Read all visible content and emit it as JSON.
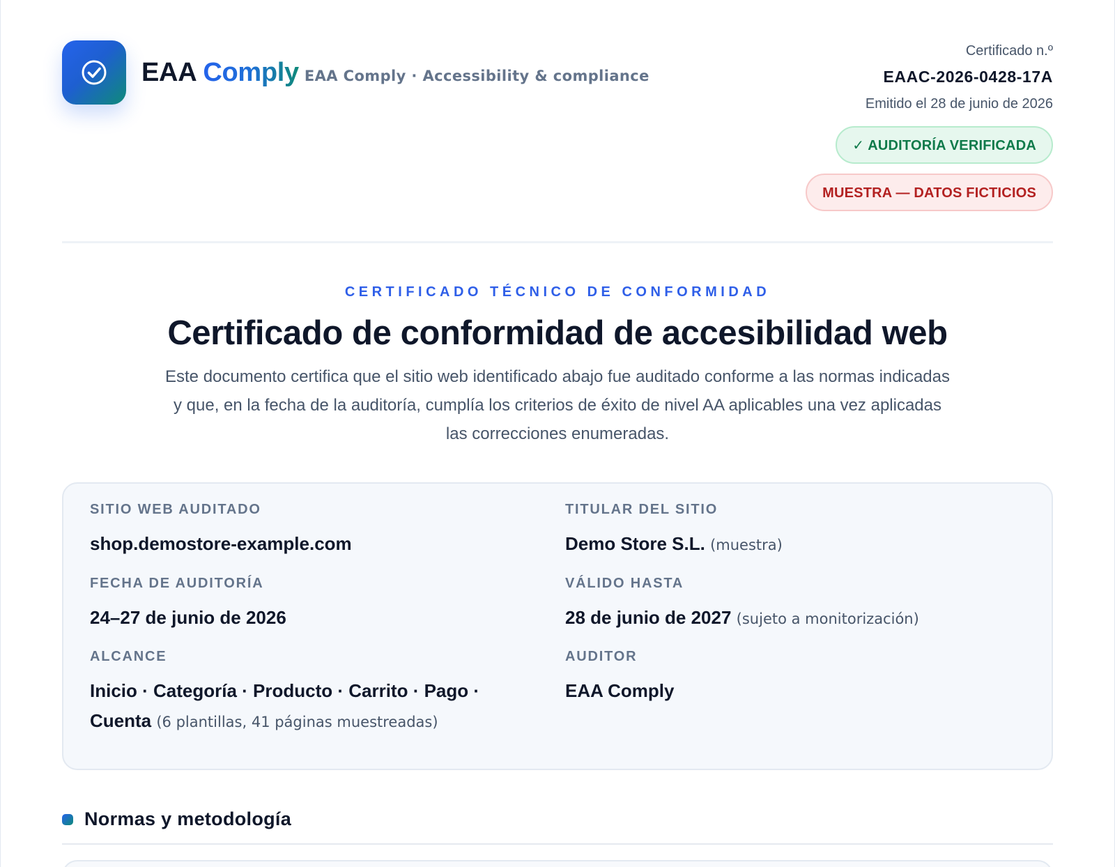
{
  "brand": {
    "name": "EAA",
    "accent": "Comply",
    "tagline": "EAA Comply · Accessibility & compliance",
    "logo_icon": "check-circle-icon"
  },
  "certificate": {
    "label": "Certificado n.º",
    "number": "EAAC-2026-0428-17A",
    "issued": "Emitido el 28 de junio de 2026",
    "badge_verified": "✓ AUDITORÍA VERIFICADA",
    "badge_sample": "MUESTRA — DATOS FICTICIOS"
  },
  "heading": {
    "eyebrow": "CERTIFICADO TÉCNICO DE CONFORMIDAD",
    "title": "Certificado de conformidad de accesibilidad web",
    "intro": "Este documento certifica que el sitio web identificado abajo fue auditado conforme a las normas indicadas y que, en la fecha de la auditoría, cumplía los criterios de éxito de nivel AA aplicables una vez aplicadas las correcciones enumeradas."
  },
  "details": {
    "site_label": "SITIO WEB AUDITADO",
    "site_value": "shop.demostore-example.com",
    "owner_label": "TITULAR DEL SITIO",
    "owner_value": "Demo Store S.L.",
    "owner_note": "(muestra)",
    "date_label": "FECHA DE AUDITORÍA",
    "date_value": "24–27 de junio de 2026",
    "valid_label": "VÁLIDO HASTA",
    "valid_value": "28 de junio de 2027",
    "valid_note": "(sujeto a monitorización)",
    "scope_label": "ALCANCE",
    "scope_value": "Inicio · Categoría · Producto · Carrito · Pago · Cuenta",
    "scope_note": "(6 plantillas, 41 páginas muestreadas)",
    "auditor_label": "AUDITOR",
    "auditor_value": "EAA Comply"
  },
  "section": {
    "title": "Normas y metodología"
  },
  "colors": {
    "accent": "#2563eb",
    "accent_teal": "#0f8a7a",
    "verified": "#0f7a4a",
    "sample": "#b32121"
  }
}
